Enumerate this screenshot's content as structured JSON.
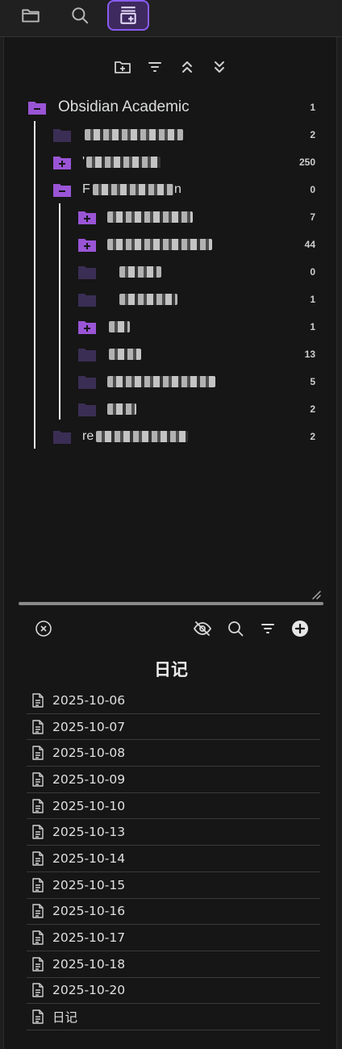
{
  "topbar": {
    "tabs": [
      {
        "icon": "folder-icon"
      },
      {
        "icon": "search-icon"
      },
      {
        "icon": "note-stack-plus-icon",
        "active": true
      }
    ]
  },
  "tree_toolbar": [
    "new-folder-icon",
    "sort-icon",
    "collapse-all-icon",
    "expand-all-icon"
  ],
  "tree": {
    "root": {
      "name": "Obsidian Academic",
      "count": "1"
    },
    "items": [
      {
        "prefix": "",
        "count": "2"
      },
      {
        "prefix": "'",
        "count": "250"
      },
      {
        "prefix": "F",
        "suffix": "n",
        "count": "0"
      },
      {
        "prefix": "",
        "count": "7"
      },
      {
        "prefix": "",
        "count": "44"
      },
      {
        "prefix": "",
        "count": "0"
      },
      {
        "prefix": "",
        "count": "1"
      },
      {
        "prefix": "",
        "count": "1"
      },
      {
        "prefix": "",
        "count": "13"
      },
      {
        "prefix": "",
        "count": "5"
      },
      {
        "prefix": "",
        "count": "2"
      },
      {
        "prefix": "re",
        "count": "2"
      }
    ]
  },
  "list_toolbar": [
    "close-circle-icon",
    "eye-off-icon",
    "search-icon",
    "filter-icon",
    "add-circle-icon"
  ],
  "list": {
    "title": "日记",
    "files": [
      "2025-10-06",
      "2025-10-07",
      "2025-10-08",
      "2025-10-09",
      "2025-10-10",
      "2025-10-13",
      "2025-10-14",
      "2025-10-15",
      "2025-10-16",
      "2025-10-17",
      "2025-10-18",
      "2025-10-20",
      "日记"
    ]
  },
  "colors": {
    "accent": "#8a5cf5",
    "folder_active": "#9a55d6",
    "folder_dim": "#3b2e55"
  }
}
